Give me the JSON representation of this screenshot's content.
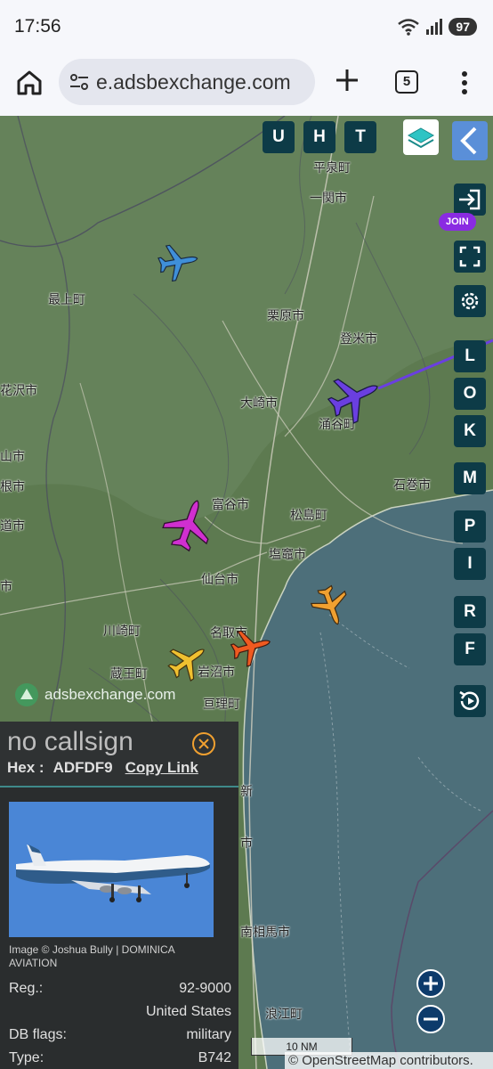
{
  "status_bar": {
    "time": "17:56",
    "battery": "97"
  },
  "browser": {
    "url": "e.adsbexchange.com",
    "tab_count": "5"
  },
  "map": {
    "top_buttons": [
      "U",
      "H",
      "T"
    ],
    "side_buttons": [
      "L",
      "O",
      "K",
      "M",
      "P",
      "I",
      "R",
      "F"
    ],
    "join_label": "JOIN",
    "watermark": "adsbexchange.com",
    "places": {
      "hiraizumi": "平泉町",
      "ichinoseki": "一関市",
      "mogami": "最上町",
      "kurihara": "栗原市",
      "tome": "登米市",
      "hanamaki": "花沢市",
      "osaki": "大崎市",
      "wakuya": "涌谷町",
      "yamashi": "山市",
      "neshi": "根市",
      "ishinomaki": "石巻市",
      "tomiya": "富谷市",
      "matsushima": "松島町",
      "dosmachi": "道市",
      "shiogama": "塩竈市",
      "sendai": "仙台市",
      "ichi": "市",
      "kawasaki": "川崎町",
      "natori": "名取市",
      "zao": "蔵王町",
      "iwanuma": "岩沼市",
      "watari": "亘理町",
      "soma_shi": "市",
      "shinchi": "新",
      "minamisoma": "南相馬市",
      "namie": "浪江町"
    },
    "scale": "10 NM",
    "attribution": "© OpenStreetMap contributors."
  },
  "aircraft_colors": [
    "#3f8fd8",
    "#6a3fe0",
    "#d02fd0",
    "#f0a030",
    "#f05a20",
    "#f0c030"
  ],
  "info_panel": {
    "callsign": "no callsign",
    "hex_label": "Hex :",
    "hex": "ADFDF9",
    "copy_link": "Copy Link",
    "image_credit": "Image © Joshua Bully | DOMINICA AVIATION",
    "reg_label": "Reg.:",
    "reg": "92-9000",
    "country": "United States",
    "db_flags_label": "DB flags:",
    "db_flags": "military",
    "type_label": "Type:",
    "type": "B742"
  }
}
